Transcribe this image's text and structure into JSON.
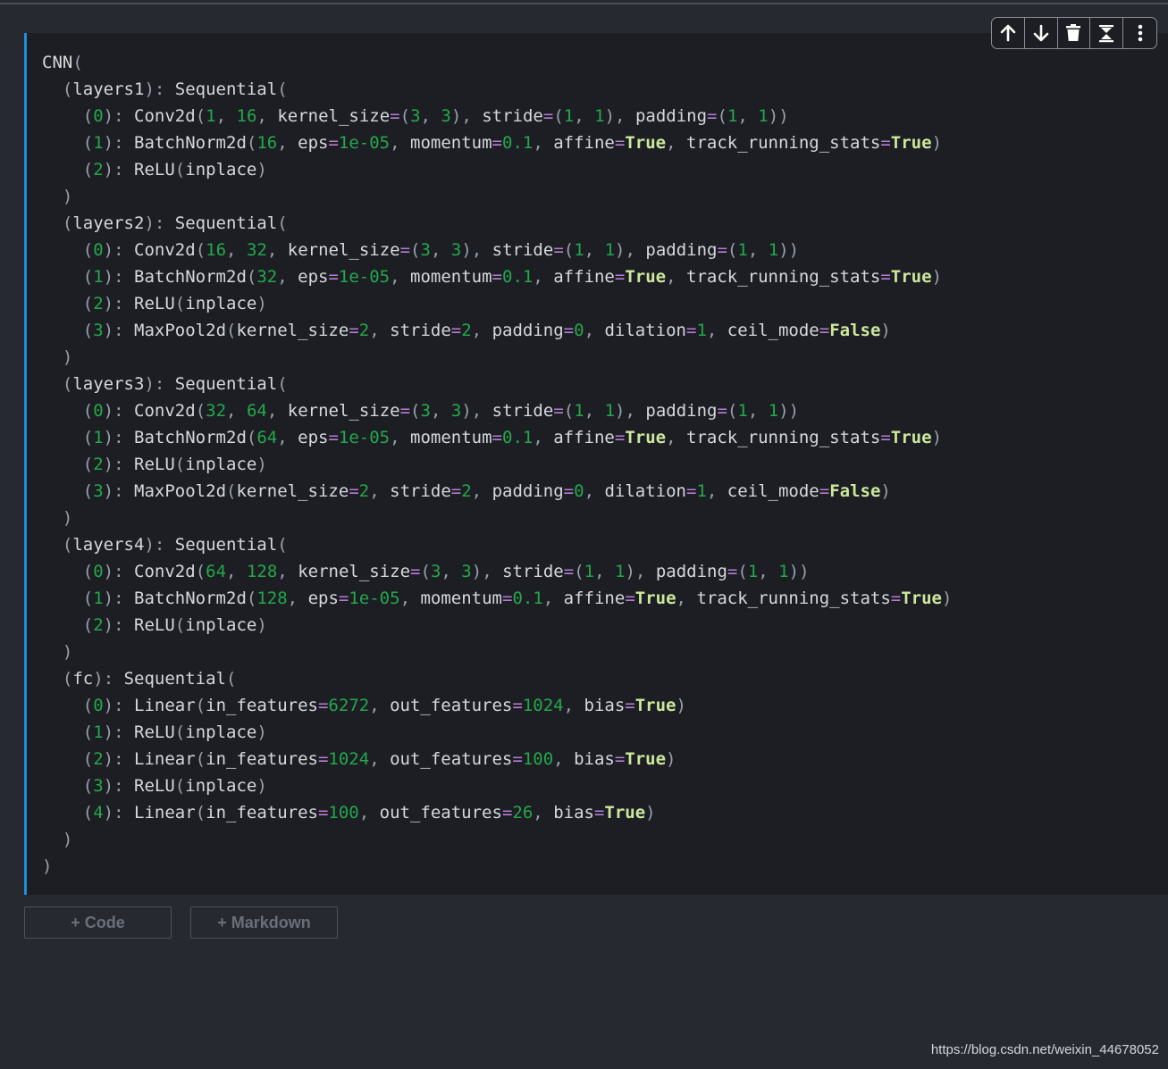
{
  "cell_toolbar": {
    "icons": [
      "move-up-icon",
      "move-down-icon",
      "delete-icon",
      "split-cell-icon",
      "more-icon"
    ]
  },
  "output_lines": [
    "CNN(",
    "  (layers1): Sequential(",
    "    (0): Conv2d(1, 16, kernel_size=(3, 3), stride=(1, 1), padding=(1, 1))",
    "    (1): BatchNorm2d(16, eps=1e-05, momentum=0.1, affine=True, track_running_stats=True)",
    "    (2): ReLU(inplace)",
    "  )",
    "  (layers2): Sequential(",
    "    (0): Conv2d(16, 32, kernel_size=(3, 3), stride=(1, 1), padding=(1, 1))",
    "    (1): BatchNorm2d(32, eps=1e-05, momentum=0.1, affine=True, track_running_stats=True)",
    "    (2): ReLU(inplace)",
    "    (3): MaxPool2d(kernel_size=2, stride=2, padding=0, dilation=1, ceil_mode=False)",
    "  )",
    "  (layers3): Sequential(",
    "    (0): Conv2d(32, 64, kernel_size=(3, 3), stride=(1, 1), padding=(1, 1))",
    "    (1): BatchNorm2d(64, eps=1e-05, momentum=0.1, affine=True, track_running_stats=True)",
    "    (2): ReLU(inplace)",
    "    (3): MaxPool2d(kernel_size=2, stride=2, padding=0, dilation=1, ceil_mode=False)",
    "  )",
    "  (layers4): Sequential(",
    "    (0): Conv2d(64, 128, kernel_size=(3, 3), stride=(1, 1), padding=(1, 1))",
    "    (1): BatchNorm2d(128, eps=1e-05, momentum=0.1, affine=True, track_running_stats=True)",
    "    (2): ReLU(inplace)",
    "  )",
    "  (fc): Sequential(",
    "    (0): Linear(in_features=6272, out_features=1024, bias=True)",
    "    (1): ReLU(inplace)",
    "    (2): Linear(in_features=1024, out_features=100, bias=True)",
    "    (3): ReLU(inplace)",
    "    (4): Linear(in_features=100, out_features=26, bias=True)",
    "  )",
    ")"
  ],
  "add_buttons": {
    "code_label": "+ Code",
    "markdown_label": "+ Markdown"
  },
  "watermark": "https://blog.csdn.net/weixin_44678052",
  "colors": {
    "cell_accent": "#1d8fd6",
    "number": "#23a84a",
    "operator": "#b77ed3",
    "keyword": "#cde89b"
  }
}
